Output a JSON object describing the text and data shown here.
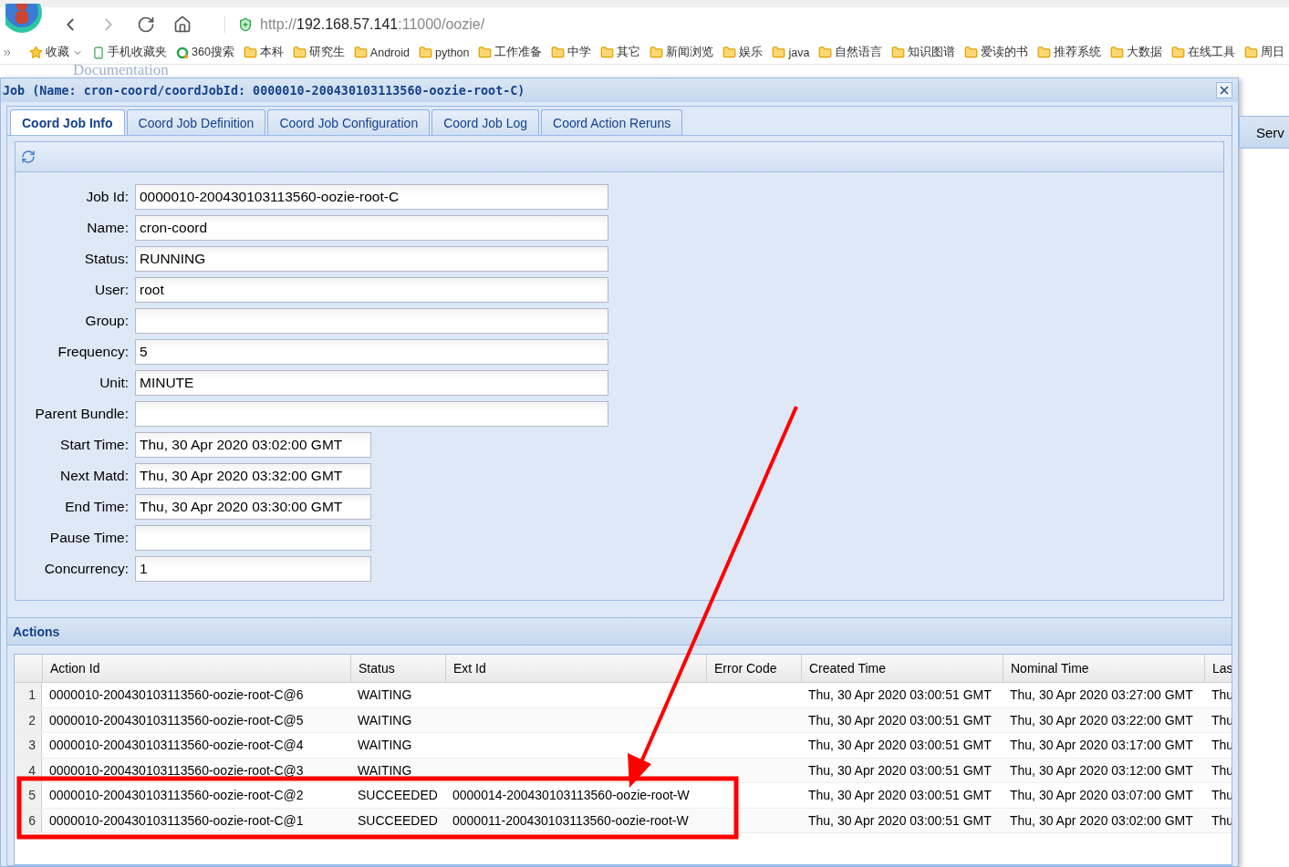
{
  "browser": {
    "url_parts": [
      "http://",
      "192.168.57.141",
      ":11000/oozie/"
    ],
    "bookmarks": [
      {
        "kind": "favorites",
        "label": "收藏"
      },
      {
        "kind": "mobile",
        "label": "手机收藏夹"
      },
      {
        "kind": "search",
        "label": "360搜索"
      },
      {
        "kind": "folder",
        "label": "本科"
      },
      {
        "kind": "folder",
        "label": "研究生"
      },
      {
        "kind": "folder",
        "label": "Android"
      },
      {
        "kind": "folder",
        "label": "python"
      },
      {
        "kind": "folder",
        "label": "工作准备"
      },
      {
        "kind": "folder",
        "label": "中学"
      },
      {
        "kind": "folder",
        "label": "其它"
      },
      {
        "kind": "folder",
        "label": "新闻浏览"
      },
      {
        "kind": "folder",
        "label": "娱乐"
      },
      {
        "kind": "folder",
        "label": "java"
      },
      {
        "kind": "folder",
        "label": "自然语言"
      },
      {
        "kind": "folder",
        "label": "知识图谱"
      },
      {
        "kind": "folder",
        "label": "爱读的书"
      },
      {
        "kind": "folder",
        "label": "推荐系统"
      },
      {
        "kind": "folder",
        "label": "大数据"
      },
      {
        "kind": "folder",
        "label": "在线工具"
      },
      {
        "kind": "folder",
        "label": "周日"
      }
    ]
  },
  "page": {
    "header": "Documentation",
    "side_panel_title": "Serv"
  },
  "dialog": {
    "title": "Job (Name: cron-coord/coordJobId: 0000010-200430103113560-oozie-root-C)",
    "tabs": [
      {
        "label": "Coord Job Info",
        "selected": true
      },
      {
        "label": "Coord Job Definition",
        "selected": false
      },
      {
        "label": "Coord Job Configuration",
        "selected": false
      },
      {
        "label": "Coord Job Log",
        "selected": false
      },
      {
        "label": "Coord Action Reruns",
        "selected": false
      }
    ],
    "fields": [
      {
        "label": "Job Id:",
        "value": "0000010-200430103113560-oozie-root-C",
        "kind": "wide"
      },
      {
        "label": "Name:",
        "value": "cron-coord",
        "kind": "wide"
      },
      {
        "label": "Status:",
        "value": "RUNNING",
        "kind": "wide"
      },
      {
        "label": "User:",
        "value": "root",
        "kind": "wide"
      },
      {
        "label": "Group:",
        "kind": "wide"
      },
      {
        "label": "Frequency:",
        "value": "5",
        "kind": "wide"
      },
      {
        "label": "Unit:",
        "value": "MINUTE",
        "kind": "wide"
      },
      {
        "label": "Parent Bundle:",
        "kind": "wide"
      },
      {
        "label": "Start Time:",
        "value": "Thu, 30 Apr 2020 03:02:00 GMT",
        "kind": "narrow"
      },
      {
        "label": "Next Matd:",
        "value": "Thu, 30 Apr 2020 03:32:00 GMT",
        "kind": "narrow"
      },
      {
        "label": "End Time:",
        "value": "Thu, 30 Apr 2020 03:30:00 GMT",
        "kind": "narrow"
      },
      {
        "label": "Pause Time:",
        "kind": "narrow"
      },
      {
        "label": "Concurrency:",
        "value": "1",
        "kind": "narrow"
      }
    ],
    "actions": {
      "title": "Actions",
      "columns": [
        "Action Id",
        "Status",
        "Ext Id",
        "Error Code",
        "Created Time",
        "Nominal Time",
        "Las"
      ],
      "rows": [
        {
          "num": "1",
          "cells": [
            "0000010-200430103113560-oozie-root-C@6",
            "WAITING",
            "",
            "",
            "Thu, 30 Apr 2020 03:00:51 GMT",
            "Thu, 30 Apr 2020 03:27:00 GMT",
            "Thu"
          ],
          "highlighted": false
        },
        {
          "num": "2",
          "cells": [
            "0000010-200430103113560-oozie-root-C@5",
            "WAITING",
            "",
            "",
            "Thu, 30 Apr 2020 03:00:51 GMT",
            "Thu, 30 Apr 2020 03:22:00 GMT",
            "Thu"
          ],
          "highlighted": false
        },
        {
          "num": "3",
          "cells": [
            "0000010-200430103113560-oozie-root-C@4",
            "WAITING",
            "",
            "",
            "Thu, 30 Apr 2020 03:00:51 GMT",
            "Thu, 30 Apr 2020 03:17:00 GMT",
            "Thu"
          ],
          "highlighted": false
        },
        {
          "num": "4",
          "cells": [
            "0000010-200430103113560-oozie-root-C@3",
            "WAITING",
            "",
            "",
            "Thu, 30 Apr 2020 03:00:51 GMT",
            "Thu, 30 Apr 2020 03:12:00 GMT",
            "Thu"
          ],
          "highlighted": false
        },
        {
          "num": "5",
          "cells": [
            "0000010-200430103113560-oozie-root-C@2",
            "SUCCEEDED",
            "0000014-200430103113560-oozie-root-W",
            "",
            "Thu, 30 Apr 2020 03:00:51 GMT",
            "Thu, 30 Apr 2020 03:07:00 GMT",
            "Thu"
          ],
          "highlighted": true
        },
        {
          "num": "6",
          "cells": [
            "0000010-200430103113560-oozie-root-C@1",
            "SUCCEEDED",
            "0000011-200430103113560-oozie-root-W",
            "",
            "Thu, 30 Apr 2020 03:00:51 GMT",
            "Thu, 30 Apr 2020 03:02:00 GMT",
            "Thu"
          ],
          "highlighted": true
        }
      ]
    }
  }
}
